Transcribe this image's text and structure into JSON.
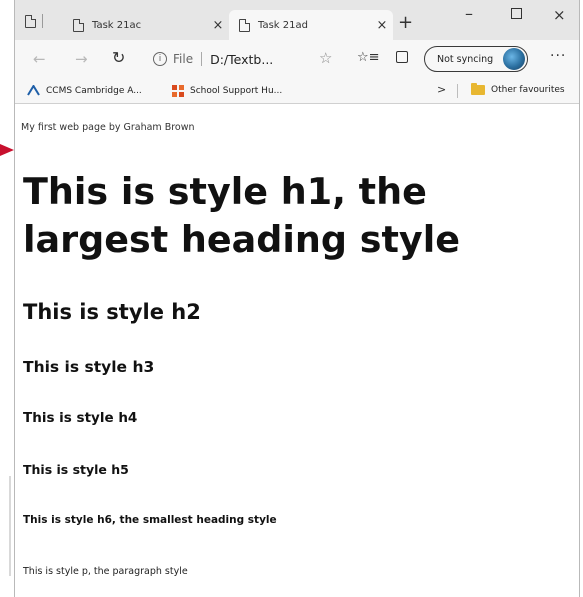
{
  "tabs": [
    {
      "title": "Task 21ac",
      "close": "×"
    },
    {
      "title": "Task 21ad",
      "close": "×"
    }
  ],
  "new_tab": "+",
  "window_controls": {
    "minimize": "–",
    "close": "×"
  },
  "toolbar": {
    "back": "←",
    "forward": "→",
    "refresh": "↻",
    "info_icon": "i",
    "file_label": "File",
    "url": "D:/Textb...",
    "star": "☆",
    "favourites": "☆≡",
    "sync_label": "Not syncing",
    "more": "···"
  },
  "favourites_bar": [
    {
      "label": "CCMS Cambridge A...",
      "icon": "ccms-icon"
    },
    {
      "label": "School Support Hu...",
      "icon": "school-icon"
    },
    {
      "label": "Other favourites",
      "icon": "folder-icon"
    }
  ],
  "favourites_chevron": ">",
  "page": {
    "byline": "My first web page by Graham Brown",
    "h1": "This is style h1, the largest heading style",
    "h2": "This is style h2",
    "h3": "This is style h3",
    "h4": "This is style h4",
    "h5": "This is style h5",
    "h6": "This is style h6, the smallest heading style",
    "p": "This is style p, the paragraph style"
  },
  "colors": {
    "annotation_arrow": "#c8102e",
    "folder": "#e8b731",
    "school_icon": "#d94a1e",
    "ccms_icon": "#1f5fa8"
  }
}
